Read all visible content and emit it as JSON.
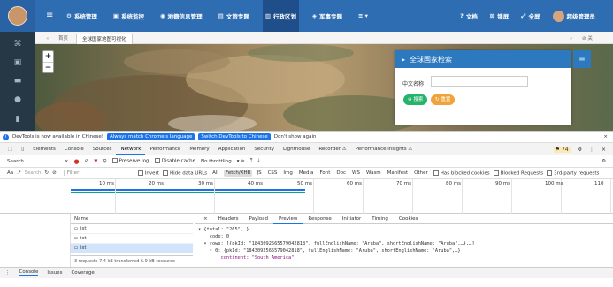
{
  "header": {
    "nav": [
      {
        "icon": "gear",
        "label": "系统管理"
      },
      {
        "icon": "monitor",
        "label": "系统监控"
      },
      {
        "icon": "map",
        "label": "地籍信息管理"
      },
      {
        "icon": "doc",
        "label": "文旅专题"
      },
      {
        "icon": "building",
        "label": "行政区划",
        "active": true
      },
      {
        "icon": "shield",
        "label": "军事专题"
      },
      {
        "icon": "more",
        "label": "≡ ▾"
      }
    ],
    "right": [
      {
        "icon": "question",
        "label": "文档"
      },
      {
        "icon": "lock",
        "label": "锁屏"
      },
      {
        "icon": "expand",
        "label": "全屏"
      },
      {
        "icon": "user",
        "label": "超级管理员"
      }
    ]
  },
  "tabs": {
    "home": "首页",
    "active": "全球国家地图可视化"
  },
  "map": {
    "zoom_in": "+",
    "zoom_out": "−"
  },
  "panel": {
    "title": "全球国家检索",
    "field_label": "中文名称：",
    "search_btn": "搜索",
    "reset_btn": "重置"
  },
  "infobar": {
    "text": "DevTools is now available in Chinese!",
    "btn1": "Always match Chrome's language",
    "btn2": "Switch DevTools to Chinese",
    "btn3": "Don't show again"
  },
  "devtabs": [
    "Elements",
    "Console",
    "Sources",
    "Network",
    "Performance",
    "Memory",
    "Application",
    "Security",
    "Lighthouse",
    "Recorder ⚠",
    "Performance insights ⚠"
  ],
  "badge": "74",
  "ntool": {
    "search": "Search",
    "preserve": "Preserve log",
    "disable_cache": "Disable cache",
    "throttle": "No throttling"
  },
  "ftool": {
    "filter": "Filter",
    "invert": "Invert",
    "hide_data": "Hide data URLs",
    "all": "All",
    "types": [
      "Fetch/XHR",
      "JS",
      "CSS",
      "Img",
      "Media",
      "Font",
      "Doc",
      "WS",
      "Wasm",
      "Manifest",
      "Other"
    ],
    "blocked_cookies": "Has blocked cookies",
    "blocked_req": "Blocked Requests",
    "third_party": "3rd-party requests",
    "aa": "Aa",
    ".*": ".*",
    "search_ph": "Search"
  },
  "timeline_ticks": [
    "10 ms",
    "20 ms",
    "30 ms",
    "40 ms",
    "50 ms",
    "60 ms",
    "70 ms",
    "80 ms",
    "90 ms",
    "100 ms",
    "110"
  ],
  "requests": {
    "header": "Name",
    "rows": [
      "list",
      "list",
      "list"
    ],
    "footer": "3 requests   7.4 kB transferred   6.9 kB resource"
  },
  "detail_tabs": [
    "Headers",
    "Payload",
    "Preview",
    "Response",
    "Initiator",
    "Timing",
    "Cookies"
  ],
  "json_lines": [
    "▾ {total: \"265\",…}",
    "    code: 0",
    "  ▾ rows: [{pkId: \"1843092565579042818\", fullEnglishName: \"Aruba\", shortEnglishName: \"Aruba\",…},…]",
    "    ▾ 0: {pkId: \"1843092565579042818\", fullEnglishName: \"Aruba\", shortEnglishName: \"Aruba\",…}",
    "        continent: \"South America\""
  ],
  "drawer": [
    "Console",
    "Issues",
    "Coverage"
  ]
}
